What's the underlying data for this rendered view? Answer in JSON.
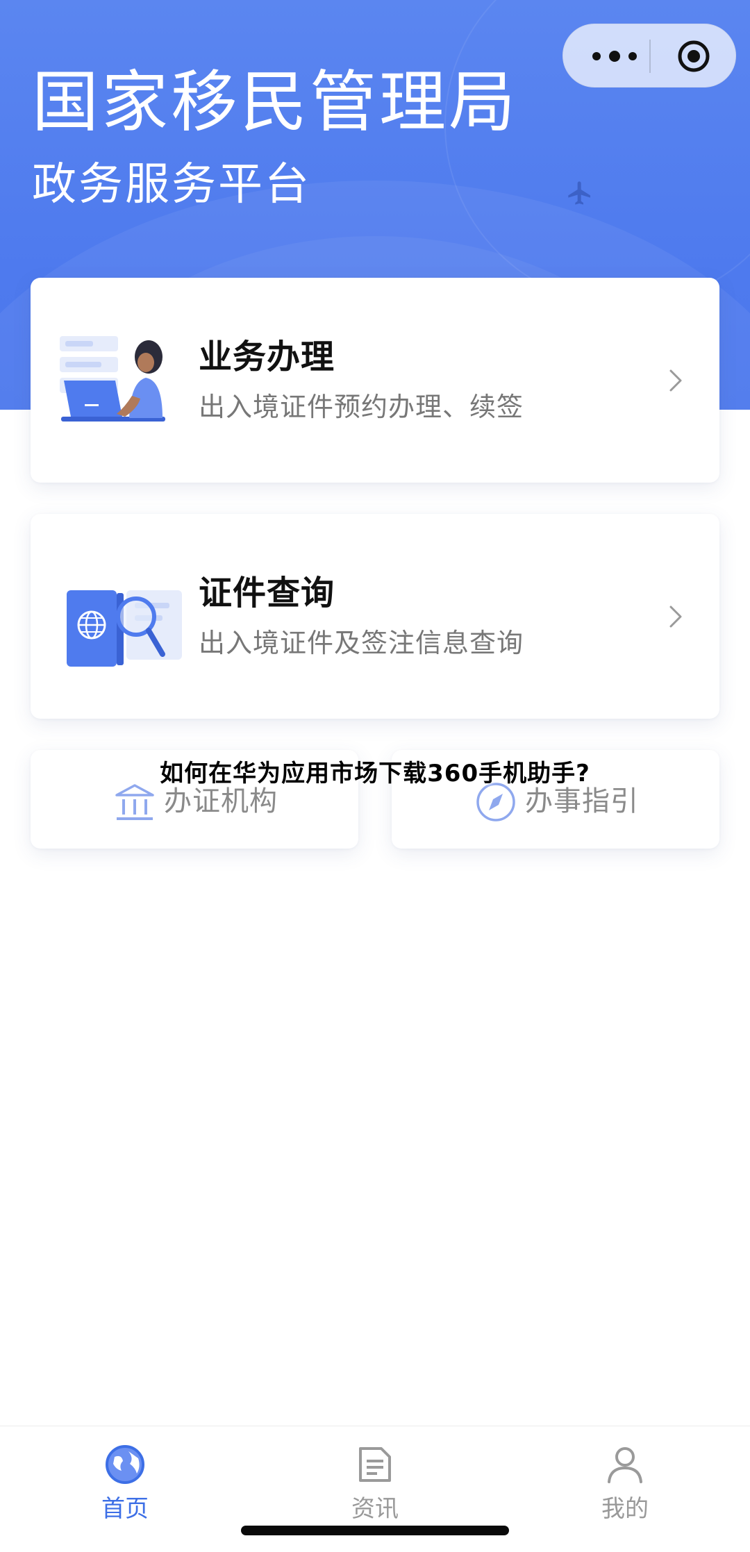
{
  "header": {
    "title": "国家移民管理局",
    "subtitle": "政务服务平台",
    "decor_icon": "airplane-icon"
  },
  "capsule": {
    "more_icon": "more-dots-icon",
    "close_icon": "target-circle-icon"
  },
  "cards": [
    {
      "title": "业务办理",
      "description": "出入境证件预约办理、续签",
      "icon": "woman-laptop-illustration"
    },
    {
      "title": "证件查询",
      "description": "出入境证件及签注信息查询",
      "icon": "passport-search-illustration"
    }
  ],
  "shortcuts": [
    {
      "label": "办证机构",
      "icon": "bank-building-icon"
    },
    {
      "label": "办事指引",
      "icon": "compass-icon"
    }
  ],
  "overlay_caption": "如何在华为应用市场下载360手机助手?",
  "tabbar": {
    "items": [
      {
        "label": "首页",
        "icon": "globe-icon",
        "active": true
      },
      {
        "label": "资讯",
        "icon": "document-icon",
        "active": false
      },
      {
        "label": "我的",
        "icon": "user-icon",
        "active": false
      }
    ]
  },
  "colors": {
    "brand_blue": "#4f7bee",
    "active_tab": "#3d6fe6",
    "inactive_tab": "#999999"
  }
}
